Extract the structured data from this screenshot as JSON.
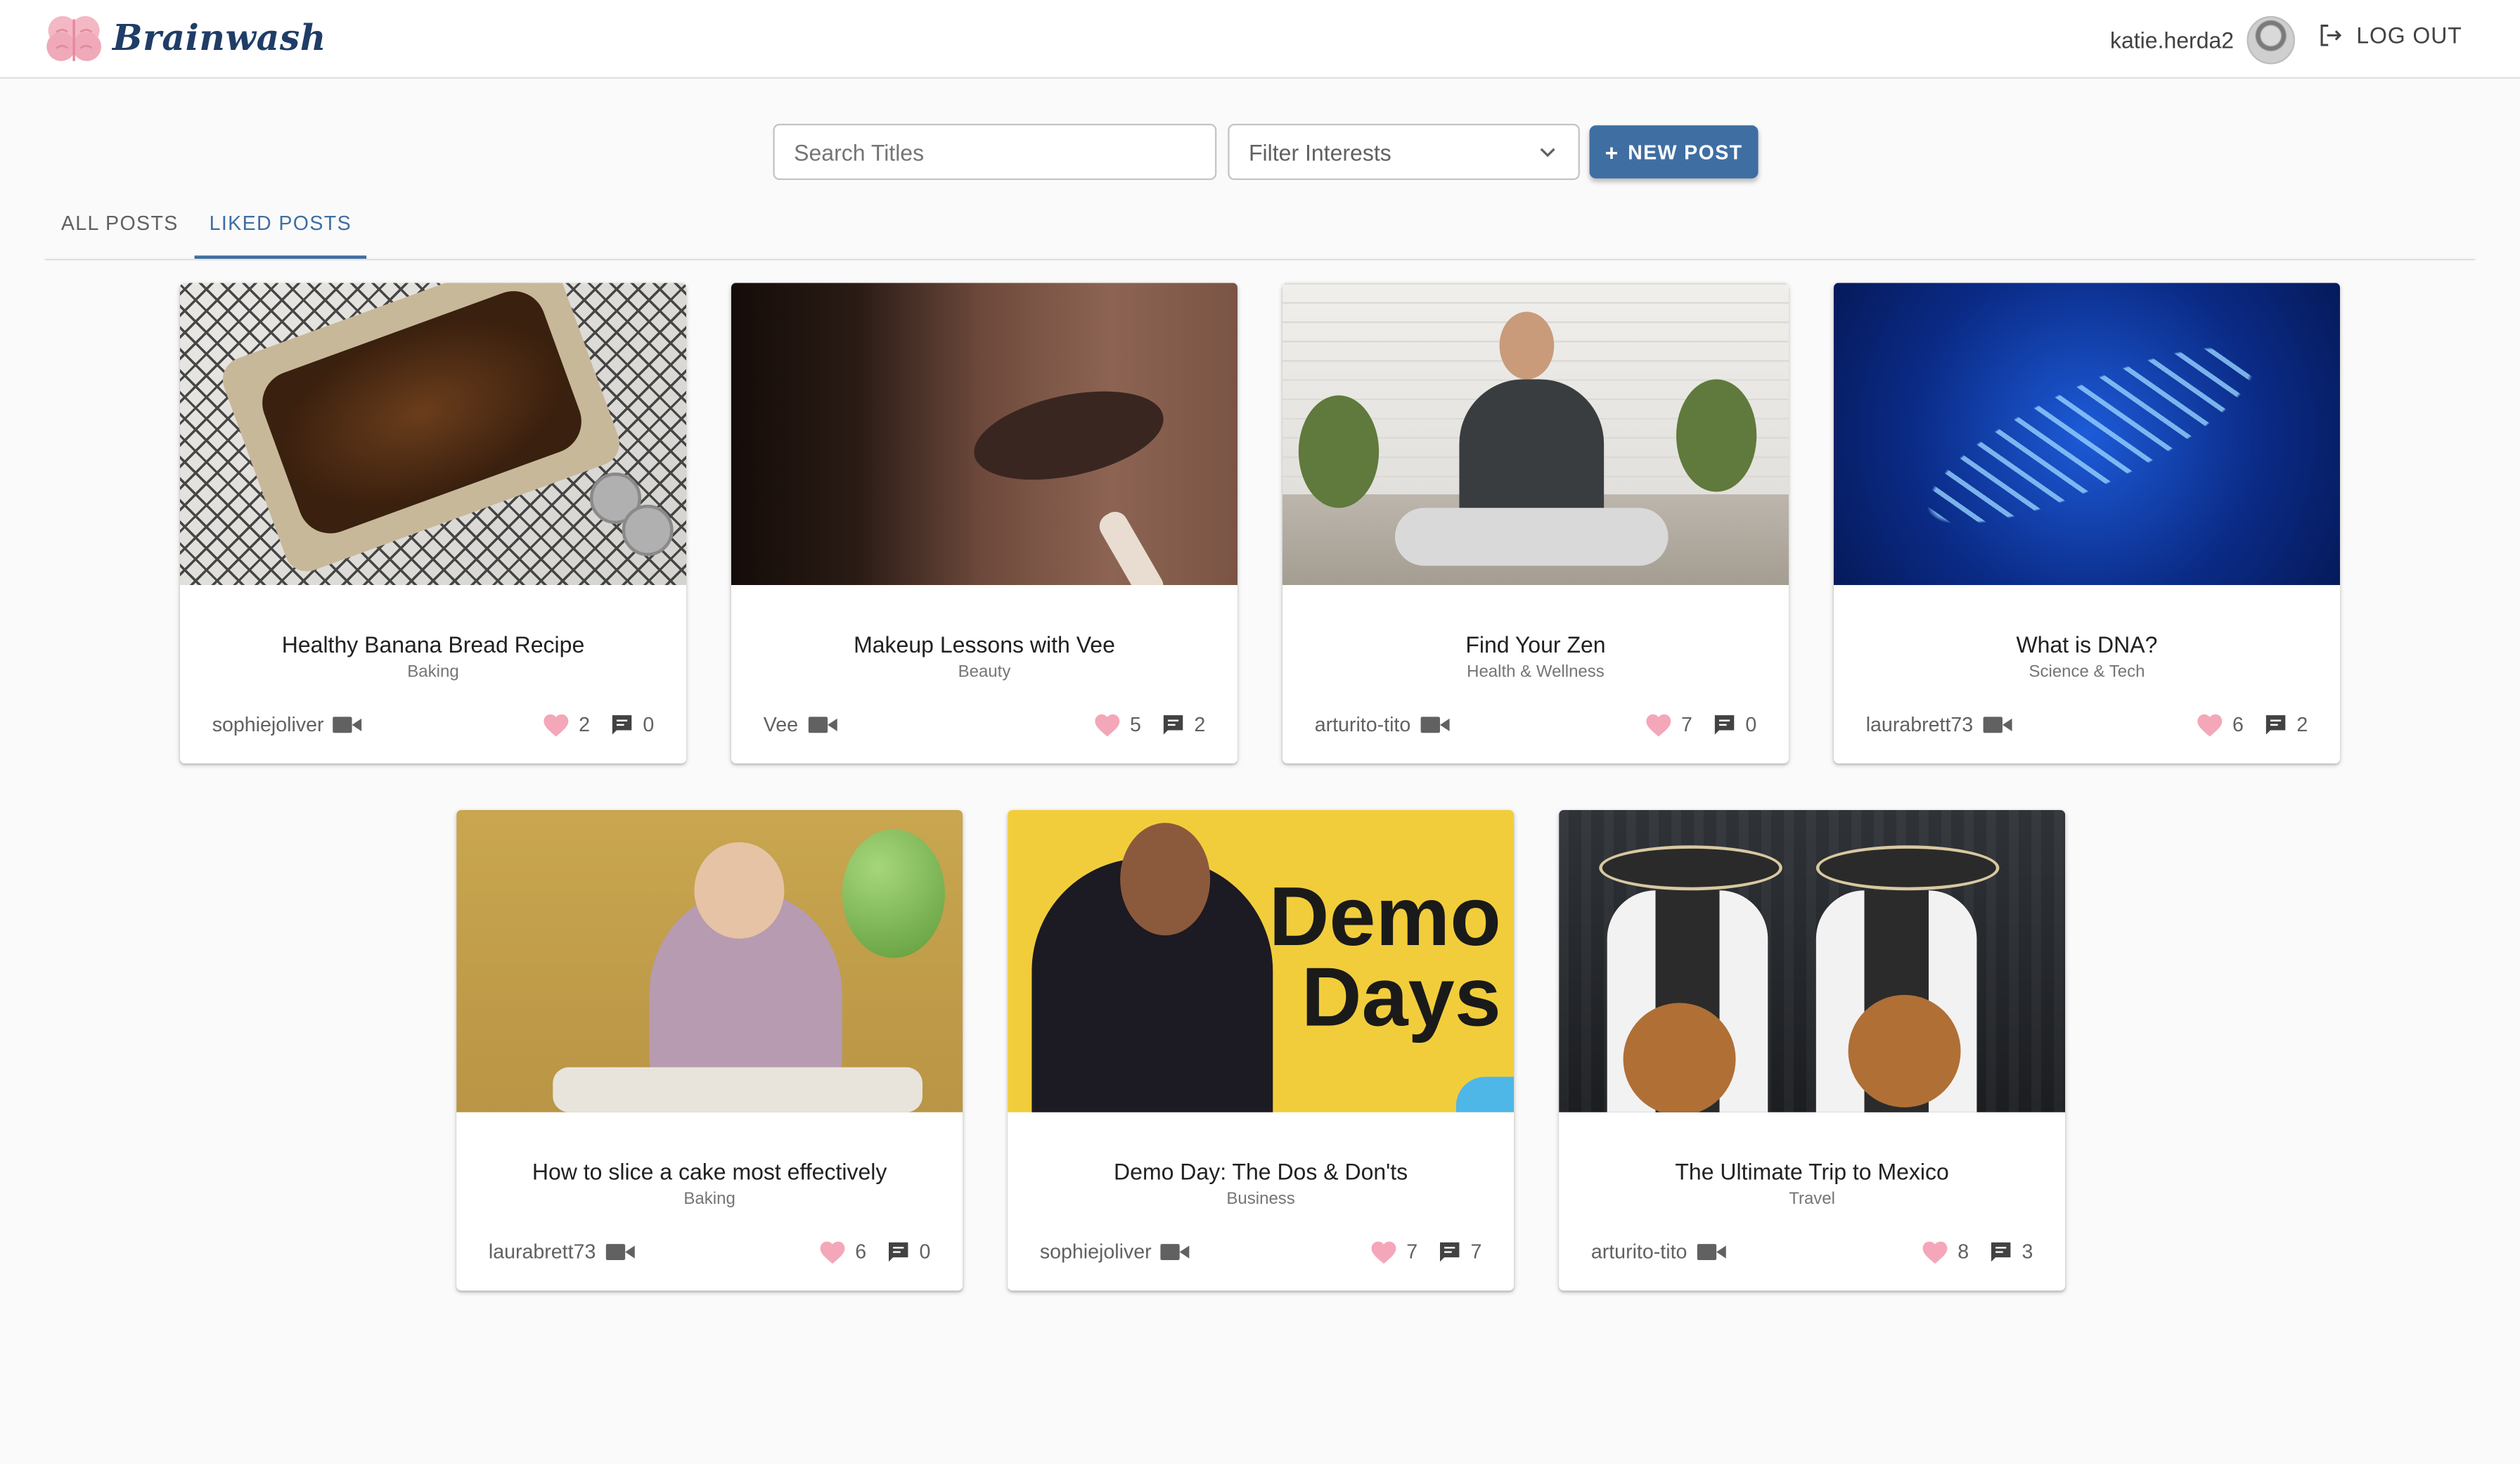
{
  "app": {
    "brand": "Brainwash",
    "username": "katie.herda2",
    "logout_label": "LOG OUT"
  },
  "toolbar": {
    "search_placeholder": "Search Titles",
    "filter_label": "Filter Interests",
    "new_post_label": "NEW POST"
  },
  "tabs": [
    {
      "label": "ALL POSTS",
      "active": false
    },
    {
      "label": "LIKED POSTS",
      "active": true
    }
  ],
  "colors": {
    "primary": "#3f6ea3",
    "like": "#f4a7b9",
    "brand_text": "#1f3d66"
  },
  "posts": [
    {
      "title": "Healthy Banana Bread Recipe",
      "category": "Baking",
      "author": "sophiejoliver",
      "likes": "2",
      "comments": "0",
      "media": "video-icon"
    },
    {
      "title": "Makeup Lessons with Vee",
      "category": "Beauty",
      "author": "Vee",
      "likes": "5",
      "comments": "2",
      "media": "video-icon"
    },
    {
      "title": "Find Your Zen",
      "category": "Health & Wellness",
      "author": "arturito-tito",
      "likes": "7",
      "comments": "0",
      "media": "video-icon"
    },
    {
      "title": "What is DNA?",
      "category": "Science & Tech",
      "author": "laurabrett73",
      "likes": "6",
      "comments": "2",
      "media": "video-icon"
    },
    {
      "title": "How to slice a cake most effectively",
      "category": "Baking",
      "author": "laurabrett73",
      "likes": "6",
      "comments": "0",
      "media": "video-icon"
    },
    {
      "title": "Demo Day: The Dos & Don'ts",
      "category": "Business",
      "author": "sophiejoliver",
      "likes": "7",
      "comments": "7",
      "media": "video-icon",
      "thumb_text": [
        "Demo",
        "Days"
      ]
    },
    {
      "title": "The Ultimate Trip to Mexico",
      "category": "Travel",
      "author": "arturito-tito",
      "likes": "8",
      "comments": "3",
      "media": "video-icon"
    }
  ]
}
